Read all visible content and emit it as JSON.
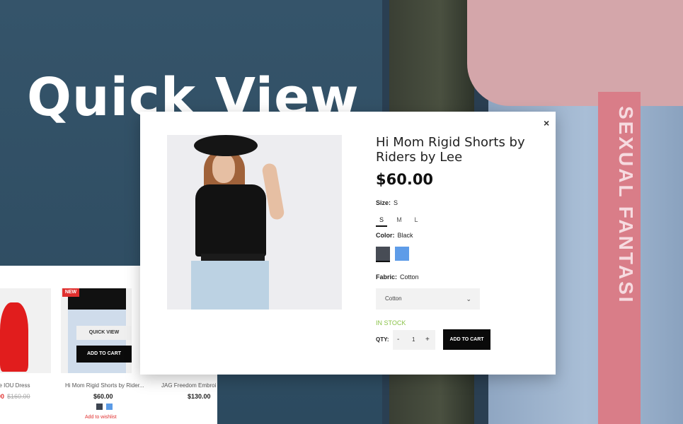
{
  "hero": {
    "title": "Quick View"
  },
  "background": {
    "strap_text": "SEXUAL FANTASI"
  },
  "listing": {
    "quick_view_label": "QUICK VIEW",
    "add_to_cart_label": "ADD TO CART",
    "new_badge": "NEW",
    "cards": [
      {
        "name": "ne IOU Dress",
        "price": "00",
        "old_price": "$160.00"
      },
      {
        "name": "Hi Mom Rigid Shorts by Rider...",
        "price": "$60.00"
      },
      {
        "name": "JAG Freedom Embroi",
        "price": "$130.00"
      }
    ],
    "wishlist_label": "Add to wishlist"
  },
  "modal": {
    "close_label": "×",
    "product": {
      "title": "Hi Mom Rigid Shorts by Riders by Lee",
      "price": "$60.00"
    },
    "size": {
      "label": "Size:",
      "value": "S",
      "options": [
        "S",
        "M",
        "L"
      ]
    },
    "color": {
      "label": "Color:",
      "value": "Black",
      "swatches": [
        "#474c55",
        "#5e9ce8"
      ]
    },
    "fabric": {
      "label": "Fabric:",
      "value": "Cotton",
      "select_value": "Cotton"
    },
    "stock": "IN STOCK",
    "qty": {
      "label": "QTY:",
      "minus": "-",
      "value": "1",
      "plus": "+"
    },
    "add_to_cart": "ADD TO CART"
  }
}
